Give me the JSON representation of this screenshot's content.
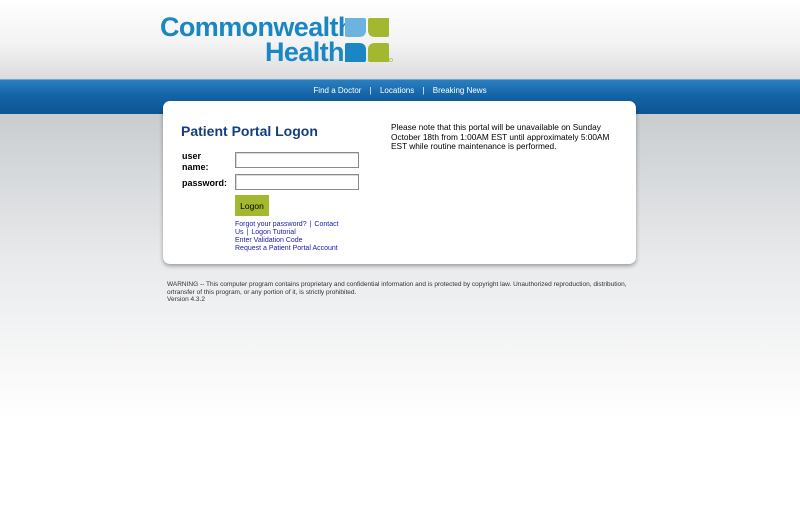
{
  "brand": {
    "line1": "Commonwealth",
    "line2": "Health",
    "colors": {
      "blue": "#1a87c4",
      "green": "#a3b82e",
      "light_blue": "#6db3e0"
    },
    "icon": "clover-cross-logo-icon"
  },
  "nav": {
    "items": [
      {
        "label": "Find a Doctor"
      },
      {
        "label": "Locations"
      },
      {
        "label": "Breaking News"
      }
    ],
    "separator": "|"
  },
  "login": {
    "title": "Patient Portal Logon",
    "username_label": "user name:",
    "password_label": "password:",
    "username_value": "",
    "password_value": "",
    "logon_button": "Logon",
    "links": {
      "forgot_password": "Forgot your password?",
      "contact_us": "Contact Us",
      "logon_tutorial": "Logon Tutorial",
      "enter_validation": "Enter Validation Code",
      "request_account": "Request a Patient Portal Account",
      "separator": "|"
    }
  },
  "notice": {
    "text": "Please note that this portal will be unavailable on Sunday October 18th from 1:00AM EST until approximately 5:00AM EST while routine maintenance is performed."
  },
  "footer": {
    "warning": "WARNING -- This computer program contains proprietary and confidential information and is protected by copyright law. Unauthorized reproduction, distribution, ortransfer of this program, or any portion of it, is strictly prohibited.",
    "version": "Version 4.3.2"
  }
}
